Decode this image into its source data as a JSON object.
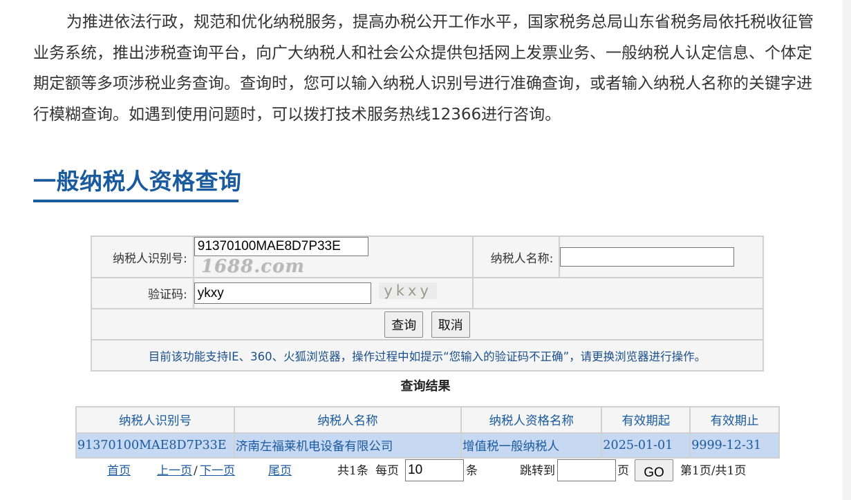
{
  "intro": {
    "text": "为推进依法行政，规范和优化纳税服务，提高办税公开工作水平，国家税务总局山东省税务局依托税收征管业务系统，推出涉税查询平台，向广大纳税人和社会公众提供包括网上发票业务、一般纳税人认定信息、个体定期定额等多项涉税业务查询。查询时，您可以输入纳税人识别号进行准确查询，或者输入纳税人名称的关键字进行模糊查询。如遇到使用问题时，可以拨打技术服务热线12366进行咨询。"
  },
  "section": {
    "title": "一般纳税人资格查询"
  },
  "form": {
    "taxpayer_id_label": "纳税人识别号:",
    "taxpayer_id_value": "91370100MAE8D7P33E",
    "logo_text": "1688.com",
    "taxpayer_name_label": "纳税人名称:",
    "taxpayer_name_value": "",
    "captcha_label": "验证码:",
    "captcha_value": "ykxy",
    "captcha_image_text": "ykxy",
    "query_button": "查询",
    "cancel_button": "取消",
    "notice": "目前该功能支持IE、360、火狐浏览器，操作过程中如提示“您输入的验证码不正确”，请更换浏览器进行操作。"
  },
  "results": {
    "title": "查询结果",
    "columns": [
      "纳税人识别号",
      "纳税人名称",
      "纳税人资格名称",
      "有效期起",
      "有效期止"
    ],
    "rows": [
      [
        "91370100MAE8D7P33E",
        "济南左福莱机电设备有限公司",
        "增值税一般纳税人",
        "2025-01-01",
        "9999-12-31"
      ]
    ]
  },
  "pager": {
    "first": "首页",
    "prev": "上一页",
    "separator": "/",
    "next": "下一页",
    "last": "尾页",
    "total": "共1条",
    "per_page_label": "每页",
    "per_page_value": "10",
    "per_page_unit": "条",
    "jump_label": "跳转到",
    "jump_value": "",
    "page_unit": "页",
    "go_button": "GO",
    "page_info": "第1页/共1页"
  },
  "colors": {
    "accent": "#1a5a9e",
    "row_highlight": "#c7d8f2",
    "cell_background": "#f5f5f5",
    "border": "#d0d0d0"
  }
}
